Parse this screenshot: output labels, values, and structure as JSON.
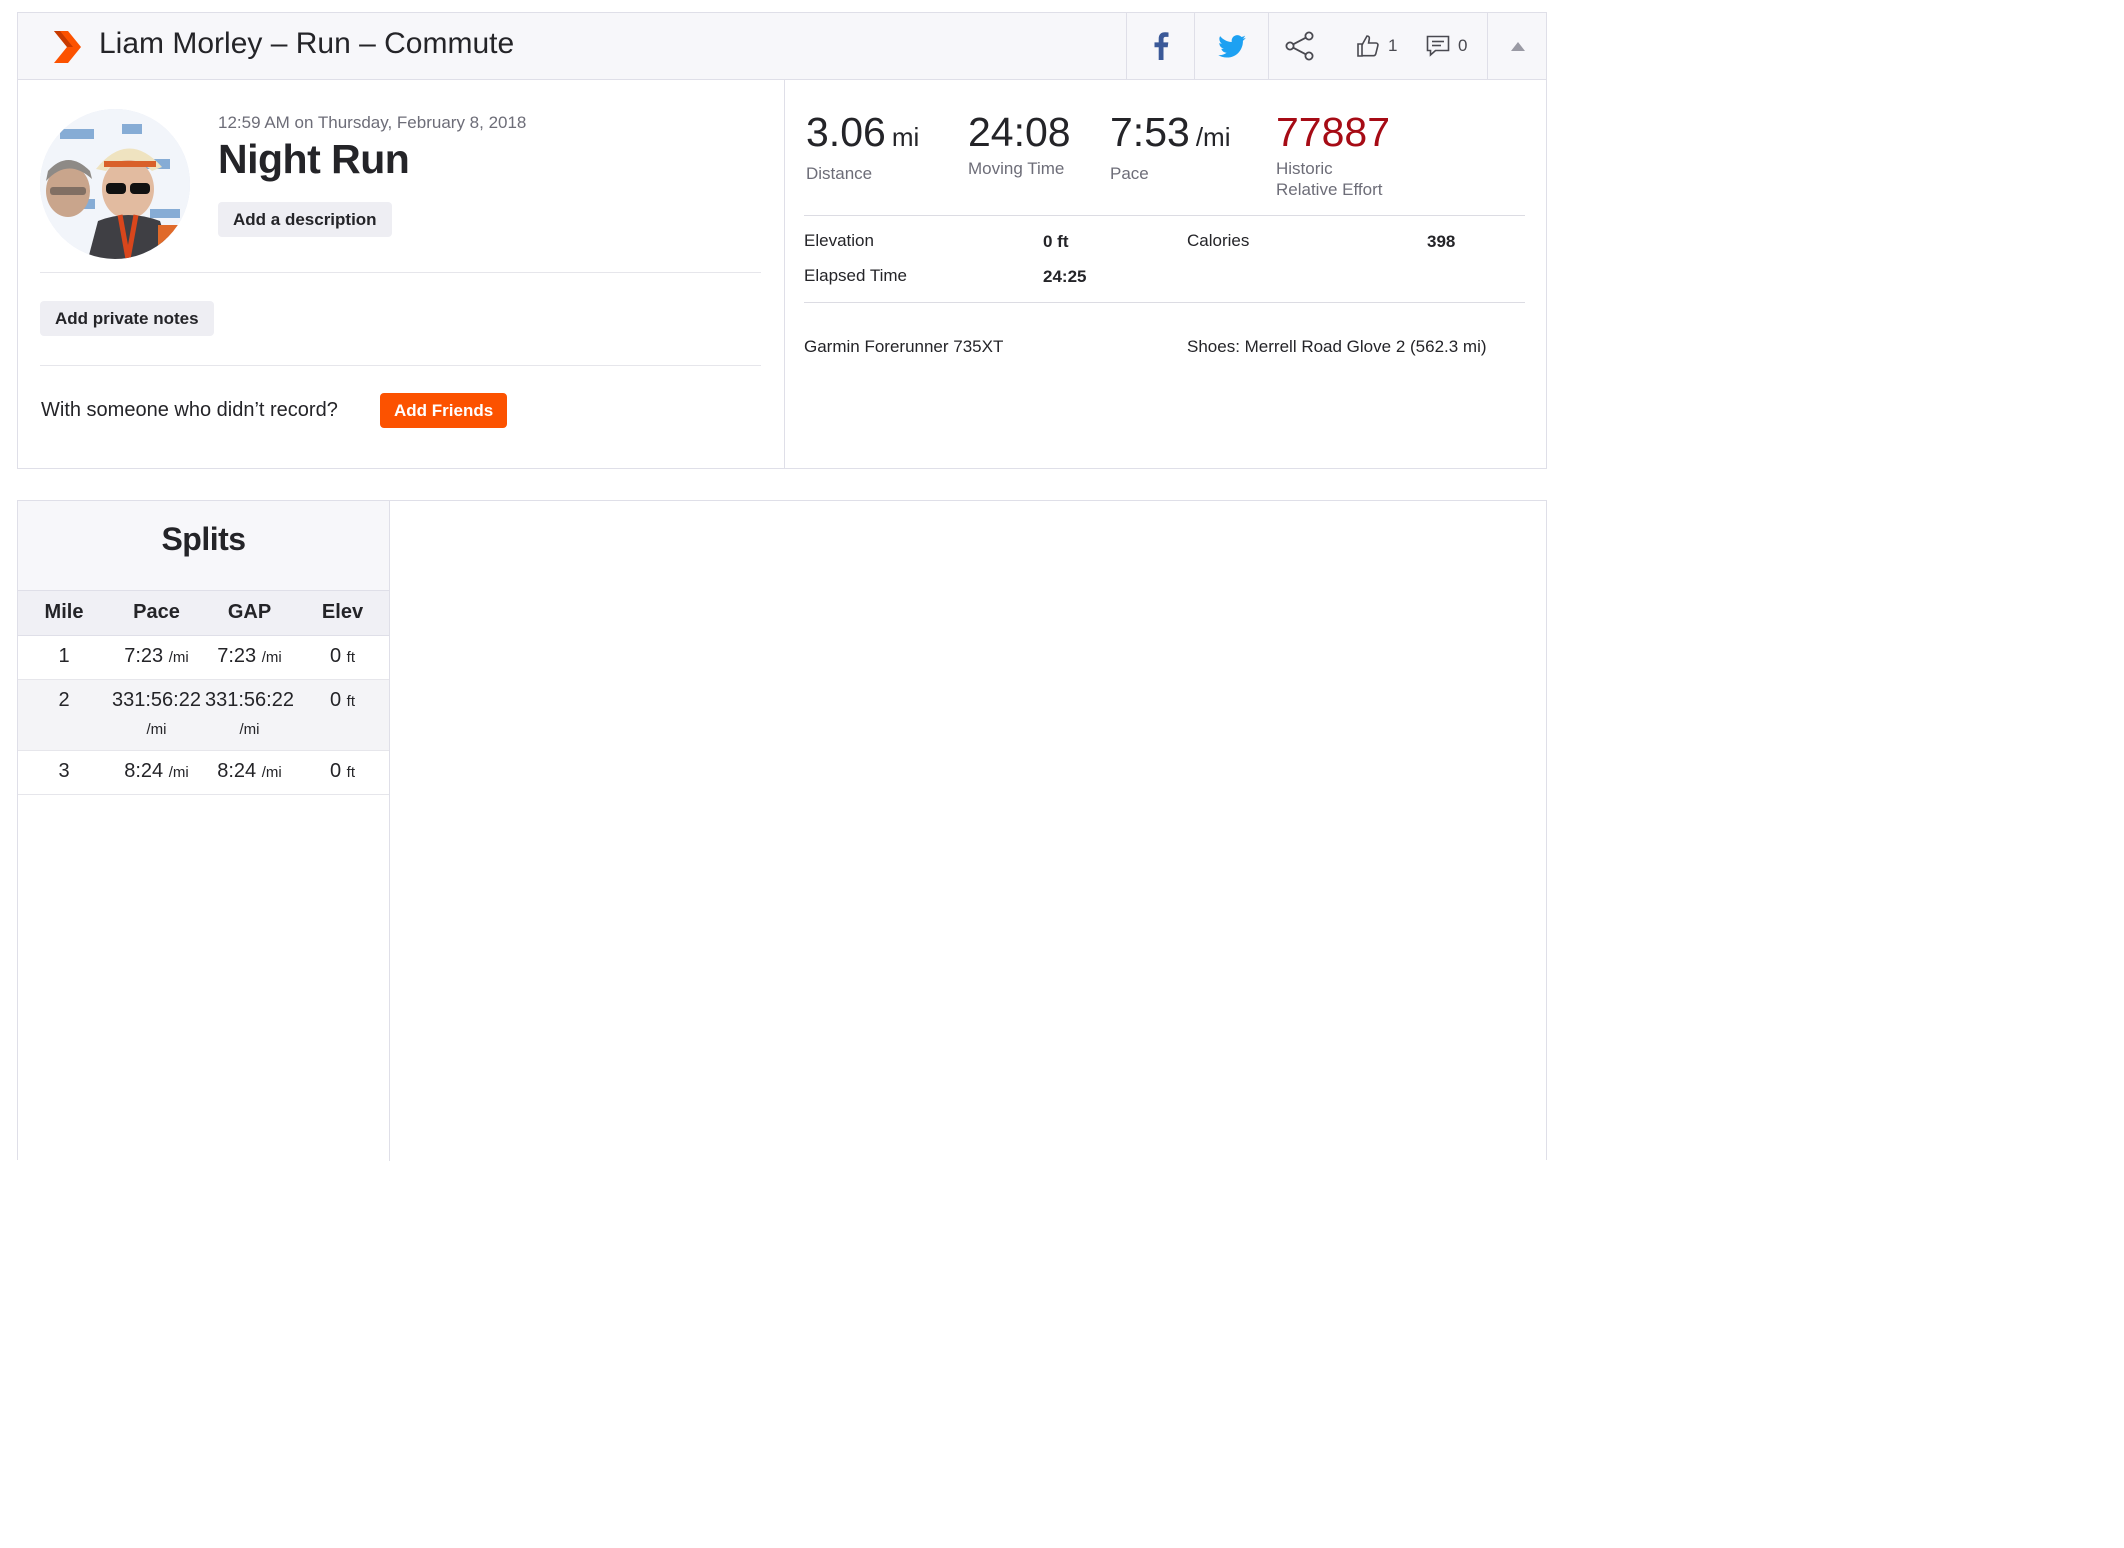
{
  "header": {
    "title": "Liam Morley – Run – Commute",
    "kudos_count": "1",
    "comments_count": "0",
    "icons": [
      "strava-chevron-icon",
      "facebook-icon",
      "twitter-icon",
      "share-icon",
      "thumbs-up-icon",
      "comment-icon",
      "caret-up-icon"
    ],
    "brand_color": "#fc5200"
  },
  "activity": {
    "date": "12:59 AM on Thursday, February 8, 2018",
    "name": "Night Run",
    "add_description_label": "Add a description",
    "add_private_notes_label": "Add private notes",
    "with_someone_text": "With someone who didn’t record?",
    "add_friends_label": "Add Friends"
  },
  "stats": {
    "distance": {
      "value": "3.06",
      "unit": "mi",
      "label": "Distance"
    },
    "moving_time": {
      "value": "24:08",
      "label": "Moving Time"
    },
    "pace": {
      "value": "7:53",
      "unit": "/mi",
      "label": "Pace"
    },
    "relative_effort": {
      "value": "77887",
      "label_line1": "Historic",
      "label_line2": "Relative Effort",
      "color": "#a60b15"
    }
  },
  "more_stats": {
    "elevation_label": "Elevation",
    "elevation_value": "0 ft",
    "calories_label": "Calories",
    "calories_value": "398",
    "elapsed_label": "Elapsed Time",
    "elapsed_value": "24:25",
    "device": "Garmin Forerunner 735XT",
    "shoes": "Shoes: Merrell Road Glove 2 (562.3 mi)"
  },
  "splits": {
    "title": "Splits",
    "headers": [
      "Mile",
      "Pace",
      "GAP",
      "Elev"
    ],
    "rows": [
      {
        "mile": "1",
        "pace": "7:23",
        "pace_unit": "/mi",
        "gap": "7:23",
        "gap_unit": "/mi",
        "elev": "0",
        "elev_unit": "ft"
      },
      {
        "mile": "2",
        "pace": "331:56:22",
        "pace_unit": "/mi",
        "gap": "331:56:22",
        "gap_unit": "/mi",
        "elev": "0",
        "elev_unit": "ft"
      },
      {
        "mile": "3",
        "pace": "8:24",
        "pace_unit": "/mi",
        "gap": "8:24",
        "gap_unit": "/mi",
        "elev": "0",
        "elev_unit": "ft"
      }
    ]
  }
}
